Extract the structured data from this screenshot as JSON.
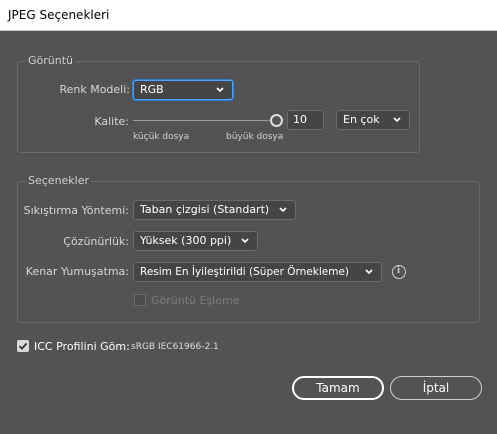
{
  "window": {
    "title": "JPEG Seçenekleri"
  },
  "image_group": {
    "title": "Görüntü",
    "color_model_label": "Renk Modeli:",
    "color_model_value": "RGB",
    "quality_label": "Kalite:",
    "quality_value": "10",
    "quality_preset": "En çok",
    "small_file": "küçük dosya",
    "large_file": "büyük dosya",
    "quality_level": 1.0
  },
  "options_group": {
    "title": "Seçenekler",
    "compression_label": "Sıkıştırma Yöntemi:",
    "compression_value": "Taban çizgisi (Standart)",
    "resolution_label": "Çözünürlük:",
    "resolution_value": "Yüksek (300 ppi)",
    "antialias_label": "Kenar Yumuşatma:",
    "antialias_value": "Resim En İyileştirildi (Süper Örnekleme)",
    "imagemap_label": "Görüntü Eşleme",
    "imagemap_checked": false
  },
  "icc": {
    "label": "ICC Profilini Göm:",
    "profile": "sRGB IEC61966-2.1",
    "checked": true
  },
  "buttons": {
    "ok": "Tamam",
    "cancel": "İptal"
  },
  "icons": {
    "dropdown": "chevron-down-icon",
    "info": "info-icon",
    "check": "checkmark-icon"
  }
}
